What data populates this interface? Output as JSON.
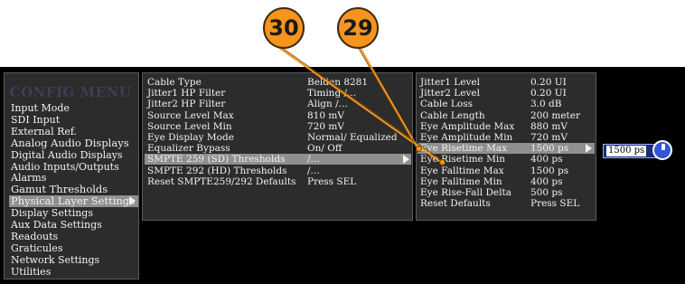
{
  "callouts": [
    "30",
    "29"
  ],
  "config_menu": {
    "title": "CONFIG MENU",
    "items": [
      "Input Mode",
      "SDI Input",
      "External Ref.",
      "Analog Audio Displays",
      "Digital Audio Displays",
      "Audio Inputs/Outputs",
      "Alarms",
      "Gamut Thresholds",
      "Physical Layer Settings",
      "Display Settings",
      "Aux Data Settings",
      "Readouts",
      "Graticules",
      "Network Settings",
      "Utilities"
    ],
    "selected_index": 8
  },
  "physical_layer": {
    "items": [
      {
        "label": "Cable Type",
        "value": "Belden 8281"
      },
      {
        "label": "Jitter1 HP Filter",
        "value": "Timing /..."
      },
      {
        "label": "Jitter2 HP Filter",
        "value": "Align /..."
      },
      {
        "label": "Source Level Max",
        "value": "810 mV"
      },
      {
        "label": "Source Level Min",
        "value": "720 mV"
      },
      {
        "label": "Eye Display Mode",
        "value": "Normal/ Equalized"
      },
      {
        "label": "Equalizer Bypass",
        "value": "On/ Off"
      },
      {
        "label": "SMPTE 259 (SD) Thresholds",
        "value": "/..."
      },
      {
        "label": "SMPTE 292 (HD) Thresholds",
        "value": "/..."
      },
      {
        "label": "Reset SMPTE259/292 Defaults",
        "value": "Press SEL"
      }
    ],
    "selected_index": 7
  },
  "thresholds": {
    "items": [
      {
        "label": "Jitter1 Level",
        "value": "0.20 UI"
      },
      {
        "label": "Jitter2 Level",
        "value": "0.20 UI"
      },
      {
        "label": "Cable Loss",
        "value": "3.0 dB"
      },
      {
        "label": "Cable Length",
        "value": "200 meter"
      },
      {
        "label": "Eye Amplitude Max",
        "value": "880 mV"
      },
      {
        "label": "Eye Amplitude Min",
        "value": "720 mV"
      },
      {
        "label": "Eye Risetime Max",
        "value": "1500 ps"
      },
      {
        "label": "Eye Risetime Min",
        "value": "400 ps"
      },
      {
        "label": "Eye Falltime Max",
        "value": "1500 ps"
      },
      {
        "label": "Eye Falltime Min",
        "value": "400 ps"
      },
      {
        "label": "Eye Rise-Fall Delta",
        "value": "500 ps"
      },
      {
        "label": "Reset Defaults",
        "value": "Press SEL"
      }
    ],
    "selected_index": 6
  },
  "edit_value": "1500 ps",
  "colors": {
    "callout": "#f7941d",
    "highlight": "#8f8f8f",
    "panel": "#2c2c2c",
    "knob": "#2f56d8"
  },
  "icons": {
    "submenu": "triangle-right",
    "adjust": "knob"
  }
}
